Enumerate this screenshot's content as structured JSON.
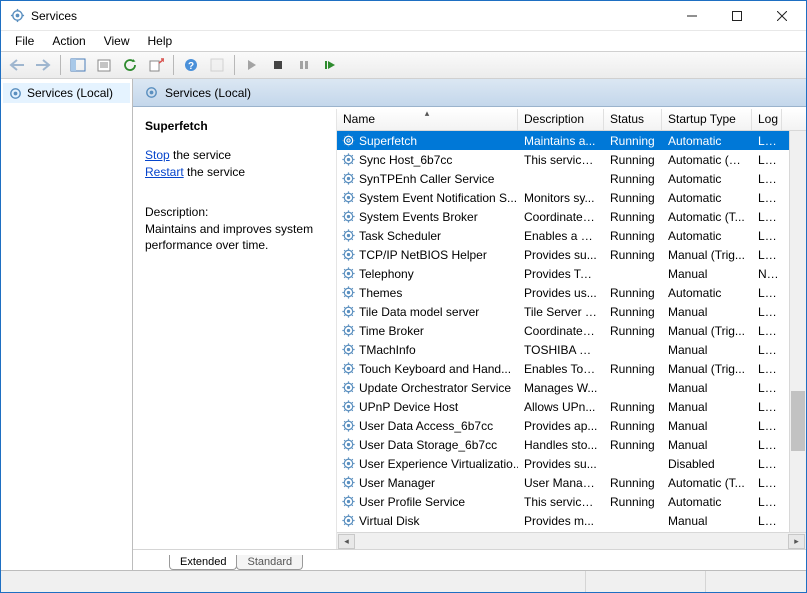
{
  "window": {
    "title": "Services"
  },
  "menu": {
    "file": "File",
    "action": "Action",
    "view": "View",
    "help": "Help"
  },
  "tree": {
    "root": "Services (Local)"
  },
  "pane": {
    "header": "Services (Local)"
  },
  "info": {
    "selected_name": "Superfetch",
    "stop_word": "Stop",
    "stop_rest": " the service",
    "restart_word": "Restart",
    "restart_rest": " the service",
    "desc_label": "Description:",
    "desc_text": "Maintains and improves system performance over time."
  },
  "columns": {
    "name": "Name",
    "desc": "Description",
    "status": "Status",
    "startup": "Startup Type",
    "logon": "Log"
  },
  "tabs": {
    "extended": "Extended",
    "standard": "Standard"
  },
  "services": [
    {
      "name": "Superfetch",
      "desc": "Maintains a...",
      "status": "Running",
      "type": "Automatic",
      "log": "Loc",
      "selected": true
    },
    {
      "name": "Sync Host_6b7cc",
      "desc": "This service ...",
      "status": "Running",
      "type": "Automatic (D...",
      "log": "Loc"
    },
    {
      "name": "SynTPEnh Caller Service",
      "desc": "",
      "status": "Running",
      "type": "Automatic",
      "log": "Loc"
    },
    {
      "name": "System Event Notification S...",
      "desc": "Monitors sy...",
      "status": "Running",
      "type": "Automatic",
      "log": "Loc"
    },
    {
      "name": "System Events Broker",
      "desc": "Coordinates...",
      "status": "Running",
      "type": "Automatic (T...",
      "log": "Loc"
    },
    {
      "name": "Task Scheduler",
      "desc": "Enables a us...",
      "status": "Running",
      "type": "Automatic",
      "log": "Loc"
    },
    {
      "name": "TCP/IP NetBIOS Helper",
      "desc": "Provides su...",
      "status": "Running",
      "type": "Manual (Trig...",
      "log": "Loc"
    },
    {
      "name": "Telephony",
      "desc": "Provides Tel...",
      "status": "",
      "type": "Manual",
      "log": "Net"
    },
    {
      "name": "Themes",
      "desc": "Provides us...",
      "status": "Running",
      "type": "Automatic",
      "log": "Loc"
    },
    {
      "name": "Tile Data model server",
      "desc": "Tile Server f...",
      "status": "Running",
      "type": "Manual",
      "log": "Loc"
    },
    {
      "name": "Time Broker",
      "desc": "Coordinates...",
      "status": "Running",
      "type": "Manual (Trig...",
      "log": "Loc"
    },
    {
      "name": "TMachInfo",
      "desc": "TOSHIBA M...",
      "status": "",
      "type": "Manual",
      "log": "Loc"
    },
    {
      "name": "Touch Keyboard and Hand...",
      "desc": "Enables Tou...",
      "status": "Running",
      "type": "Manual (Trig...",
      "log": "Loc"
    },
    {
      "name": "Update Orchestrator Service",
      "desc": "Manages W...",
      "status": "",
      "type": "Manual",
      "log": "Loc"
    },
    {
      "name": "UPnP Device Host",
      "desc": "Allows UPn...",
      "status": "Running",
      "type": "Manual",
      "log": "Loc"
    },
    {
      "name": "User Data Access_6b7cc",
      "desc": "Provides ap...",
      "status": "Running",
      "type": "Manual",
      "log": "Loc"
    },
    {
      "name": "User Data Storage_6b7cc",
      "desc": "Handles sto...",
      "status": "Running",
      "type": "Manual",
      "log": "Loc"
    },
    {
      "name": "User Experience Virtualizatio...",
      "desc": "Provides su...",
      "status": "",
      "type": "Disabled",
      "log": "Loc"
    },
    {
      "name": "User Manager",
      "desc": "User Manag...",
      "status": "Running",
      "type": "Automatic (T...",
      "log": "Loc"
    },
    {
      "name": "User Profile Service",
      "desc": "This service ...",
      "status": "Running",
      "type": "Automatic",
      "log": "Loc"
    },
    {
      "name": "Virtual Disk",
      "desc": "Provides m...",
      "status": "",
      "type": "Manual",
      "log": "Loc"
    }
  ]
}
